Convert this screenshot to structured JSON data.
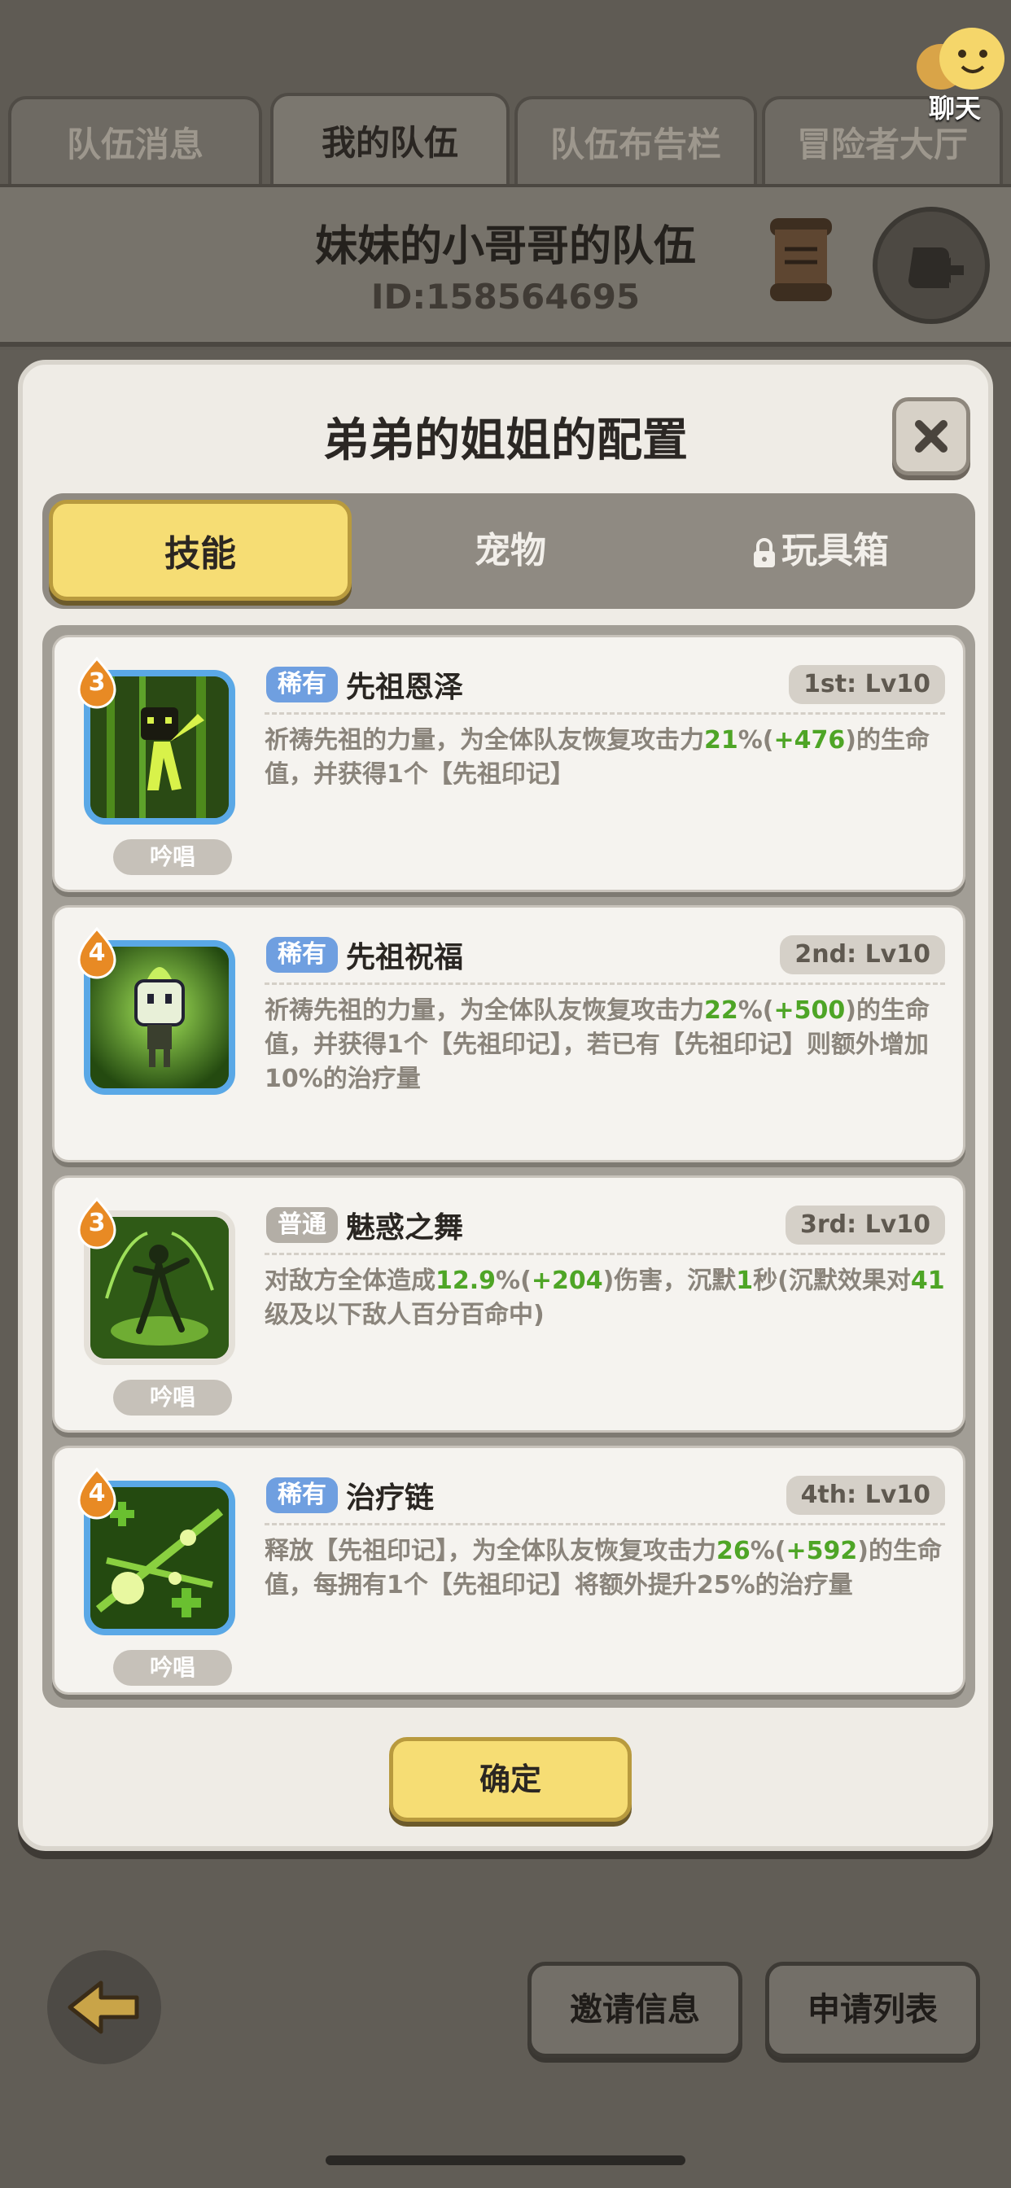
{
  "top_tabs": [
    "队伍消息",
    "我的队伍",
    "队伍布告栏",
    "冒险者大厅"
  ],
  "active_tab_index": 1,
  "chat_label": "聊天",
  "team": {
    "name": "妹妹的小哥哥的队伍",
    "id_text": "ID:158564695"
  },
  "modal": {
    "title": "弟弟的姐姐的配置",
    "segments": [
      "技能",
      "宠物",
      "玩具箱"
    ],
    "active_segment": 0,
    "confirm_label": "确定"
  },
  "skills": [
    {
      "level": "3",
      "rarity": "稀有",
      "rarity_type": "rare",
      "name": "先祖恩泽",
      "slot": "1st: Lv10",
      "cast_tag": "吟唱",
      "desc": [
        {
          "t": "祈祷先祖的力量，为全体队友恢复攻击力"
        },
        {
          "t": "21",
          "h": true
        },
        {
          "t": "%("
        },
        {
          "t": "+476",
          "h": true
        },
        {
          "t": ")的生命值，并获得1个【先祖印记】"
        }
      ]
    },
    {
      "level": "4",
      "rarity": "稀有",
      "rarity_type": "rare",
      "name": "先祖祝福",
      "slot": "2nd: Lv10",
      "cast_tag": "",
      "desc": [
        {
          "t": "祈祷先祖的力量，为全体队友恢复攻击力"
        },
        {
          "t": "22",
          "h": true
        },
        {
          "t": "%("
        },
        {
          "t": "+500",
          "h": true
        },
        {
          "t": ")的生命值，并获得1个【先祖印记】，若已有【先祖印记】则额外增加10%的治疗量"
        }
      ]
    },
    {
      "level": "3",
      "rarity": "普通",
      "rarity_type": "common",
      "name": "魅惑之舞",
      "slot": "3rd: Lv10",
      "cast_tag": "吟唱",
      "desc": [
        {
          "t": "对敌方全体造成"
        },
        {
          "t": "12.9",
          "h": true
        },
        {
          "t": "%("
        },
        {
          "t": "+204",
          "h": true
        },
        {
          "t": ")伤害，沉默"
        },
        {
          "t": "1",
          "h": true
        },
        {
          "t": "秒(沉默效果对"
        },
        {
          "t": "41",
          "h": true
        },
        {
          "t": "级及以下敌人百分百命中)"
        }
      ]
    },
    {
      "level": "4",
      "rarity": "稀有",
      "rarity_type": "rare",
      "name": "治疗链",
      "slot": "4th: Lv10",
      "cast_tag": "吟唱",
      "desc": [
        {
          "t": "释放【先祖印记】，为全体队友恢复攻击力"
        },
        {
          "t": "26",
          "h": true
        },
        {
          "t": "%("
        },
        {
          "t": "+592",
          "h": true
        },
        {
          "t": ")的生命值，每拥有1个【先祖印记】将额外提升25%的治疗量"
        }
      ]
    }
  ],
  "bottom_buttons": [
    "邀请信息",
    "申请列表"
  ],
  "icons": [
    "chat-bubble-icon",
    "scroll-icon",
    "exit-icon",
    "close-icon",
    "lock-icon",
    "back-arrow-icon"
  ],
  "colors": {
    "accent_yellow": "#f6dd74",
    "rare_blue": "#6f9fe0",
    "highlight_green": "#4ea526"
  }
}
